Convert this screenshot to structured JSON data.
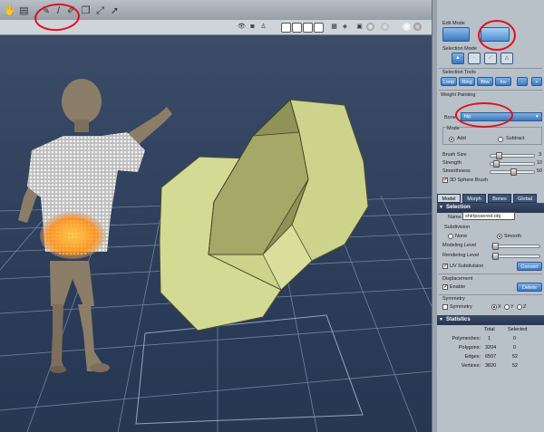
{
  "toolbar": {
    "tools": [
      "hand-tool-icon",
      "page-tool-icon",
      "pen-brush-icon",
      "smudge-icon",
      "brush-tool-icon",
      "copy-icon",
      "scale-icon",
      "cursor-icon"
    ],
    "view_icons": [
      "eye-icon",
      "camera-icon",
      "figure-icon",
      "shade-1",
      "shade-2",
      "shade-3",
      "shade-4",
      "grid-shade-icon",
      "cube-icon",
      "box-icon",
      "sphere-icon",
      "sphere-lit-icon",
      "sphere-white-icon"
    ]
  },
  "panel": {
    "edit_mode_label": "Edit Mode",
    "selection_mode_label": "Selection Mode",
    "selection_tools_label": "Selection Tools",
    "selection_tools": [
      "Loop",
      "Ring",
      "Btw",
      "Inv",
      "-",
      "+"
    ],
    "weight_painting_label": "Weight Painting",
    "bone_label": "Bone",
    "bone_value": "hip",
    "mode_label": "Mode",
    "mode_add": "Add",
    "mode_subtract": "Subtract",
    "brush_size_label": "Brush Size",
    "brush_size_value": "3",
    "strength_label": "Strength",
    "strength_value": "10",
    "smoothness_label": "Smoothness",
    "smoothness_value": "50",
    "sphere_brush_label": "3D Sphere Brush",
    "tabs": [
      "Model",
      "Morph",
      "Bones",
      "Global"
    ],
    "selection_header": "Selection",
    "name_label": "Name",
    "name_value": "shirtposered.obj",
    "subdivision_label": "Subdivision",
    "sub_none": "None",
    "sub_smooth": "Smooth",
    "modeling_level_label": "Modeling Level",
    "rendering_level_label": "Rendering Level",
    "uv_subdivision_label": "UV Subdivision",
    "convert_label": "Convert",
    "displacement_label": "Displacement",
    "enable_label": "Enable",
    "delete_label": "Delete",
    "symmetry_header": "Symmetry",
    "symmetry_label": "Symmetry",
    "sym_x": "X",
    "sym_y": "Y",
    "sym_z": "Z",
    "statistics_header": "Statistics",
    "stats_total": "Total",
    "stats_selected": "Selected",
    "stats": [
      {
        "label": "Polymeshes:",
        "total": "1",
        "selected": "0"
      },
      {
        "label": "Polygons:",
        "total": "3204",
        "selected": "0"
      },
      {
        "label": "Edges:",
        "total": "6507",
        "selected": "52"
      },
      {
        "label": "Vertices:",
        "total": "3820",
        "selected": "52"
      }
    ]
  },
  "colors": {
    "viewport_bg": "#2b3d59",
    "grid": "#7f90b0",
    "prism": "#d3da94",
    "figure": "#8c7d68",
    "annotation": "#e1101e",
    "accent_button": "#3c78bf"
  }
}
